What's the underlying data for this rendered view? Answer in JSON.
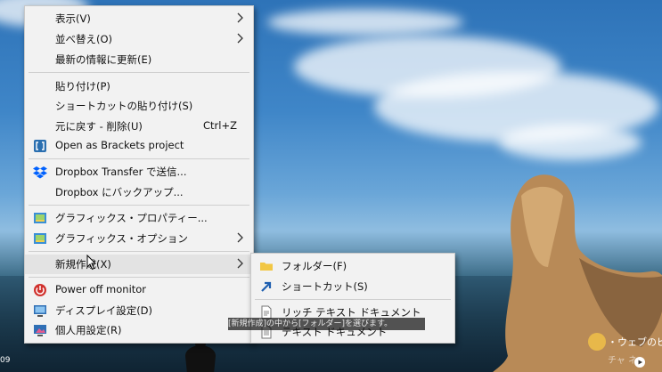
{
  "context_menu": {
    "items": [
      {
        "label": "表示(V)"
      },
      {
        "label": "並べ替え(O)"
      },
      {
        "label": "最新の情報に更新(E)"
      },
      {
        "label": "貼り付け(P)"
      },
      {
        "label": "ショートカットの貼り付け(S)"
      },
      {
        "label": "元に戻す - 削除(U)",
        "shortcut": "Ctrl+Z"
      },
      {
        "label": "Open as Brackets project"
      },
      {
        "label": "Dropbox Transfer で送信..."
      },
      {
        "label": "Dropbox にバックアップ..."
      },
      {
        "label": "グラフィックス・プロパティー..."
      },
      {
        "label": "グラフィックス・オプション"
      },
      {
        "label": "新規作成(X)"
      },
      {
        "label": "Power off monitor"
      },
      {
        "label": "ディスプレイ設定(D)"
      },
      {
        "label": "個人用設定(R)"
      }
    ]
  },
  "submenu": {
    "items": [
      {
        "label": "フォルダー(F)"
      },
      {
        "label": "ショートカット(S)"
      },
      {
        "label": "リッチ テキスト ドキュメント"
      },
      {
        "label": "テキスト ドキュメント"
      }
    ]
  },
  "video": {
    "subtitle": "[新規作成]の中から[フォルダー]を選びます。",
    "timestamp": "09",
    "logo_text_1": "・ウェブのピ",
    "logo_text_2": "チャ ネ"
  },
  "colors": {
    "folder": "#f2c744",
    "shortcut_arrow": "#1f5fb0",
    "brackets": "#2a6fb0",
    "dropbox": "#0061fe",
    "power": "#d0312d"
  }
}
